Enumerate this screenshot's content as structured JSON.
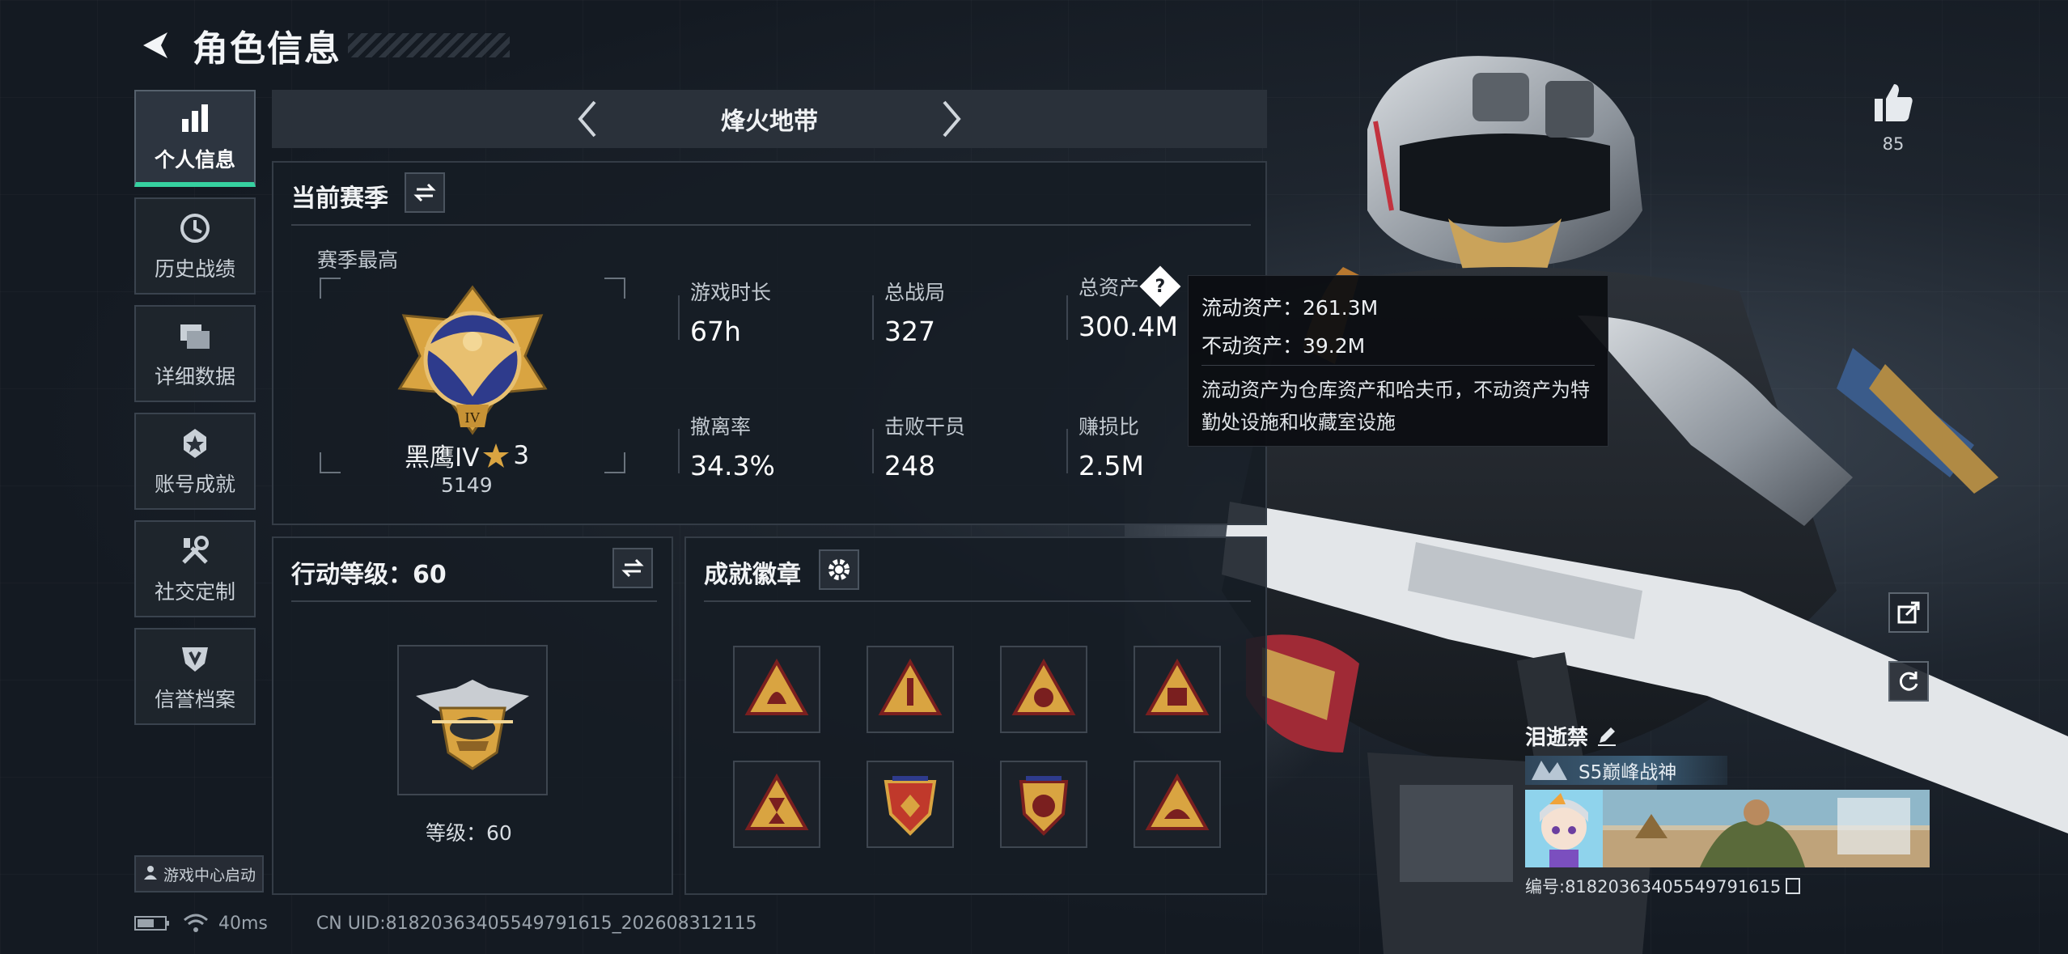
{
  "header": {
    "title": "角色信息"
  },
  "nav": {
    "items": [
      {
        "label": "个人信息",
        "icon": "bar-chart-icon"
      },
      {
        "label": "历史战绩",
        "icon": "history-icon"
      },
      {
        "label": "详细数据",
        "icon": "folders-icon"
      },
      {
        "label": "账号成就",
        "icon": "achievement-icon"
      },
      {
        "label": "社交定制",
        "icon": "tools-icon"
      },
      {
        "label": "信誉档案",
        "icon": "shield-icon"
      }
    ],
    "game_center_label": "游戏中心启动"
  },
  "mode": {
    "title": "烽火地带"
  },
  "season": {
    "title": "当前赛季",
    "subtitle": "赛季最高",
    "rank_name": "黑鹰IV",
    "rank_stars": "3",
    "rank_score": "5149",
    "stats": [
      {
        "label": "游戏时长",
        "value": "67h"
      },
      {
        "label": "总战局",
        "value": "327"
      },
      {
        "label": "总资产",
        "value": "300.4M"
      },
      {
        "label": "撤离率",
        "value": "34.3%"
      },
      {
        "label": "击败干员",
        "value": "248"
      },
      {
        "label": "赚损比",
        "value": "2.5M"
      }
    ]
  },
  "tooltip": {
    "liquid": "流动资产：261.3M",
    "fixed": "不动资产：39.2M",
    "desc": "流动资产为仓库资产和哈夫币，不动资产为特勤处设施和收藏室设施"
  },
  "action_level": {
    "title": "行动等级：60",
    "level_text": "等级：60"
  },
  "achievements": {
    "title": "成就徽章"
  },
  "like": {
    "count": "85"
  },
  "card": {
    "name": "泪逝禁",
    "title": "S5巅峰战神",
    "id_text": "编号:81820363405549791615"
  },
  "status": {
    "ping": "40ms",
    "uid": "CN UID:81820363405549791615_202608312115"
  },
  "colors": {
    "accent": "#36d1a0",
    "gold": "#d9a441"
  }
}
